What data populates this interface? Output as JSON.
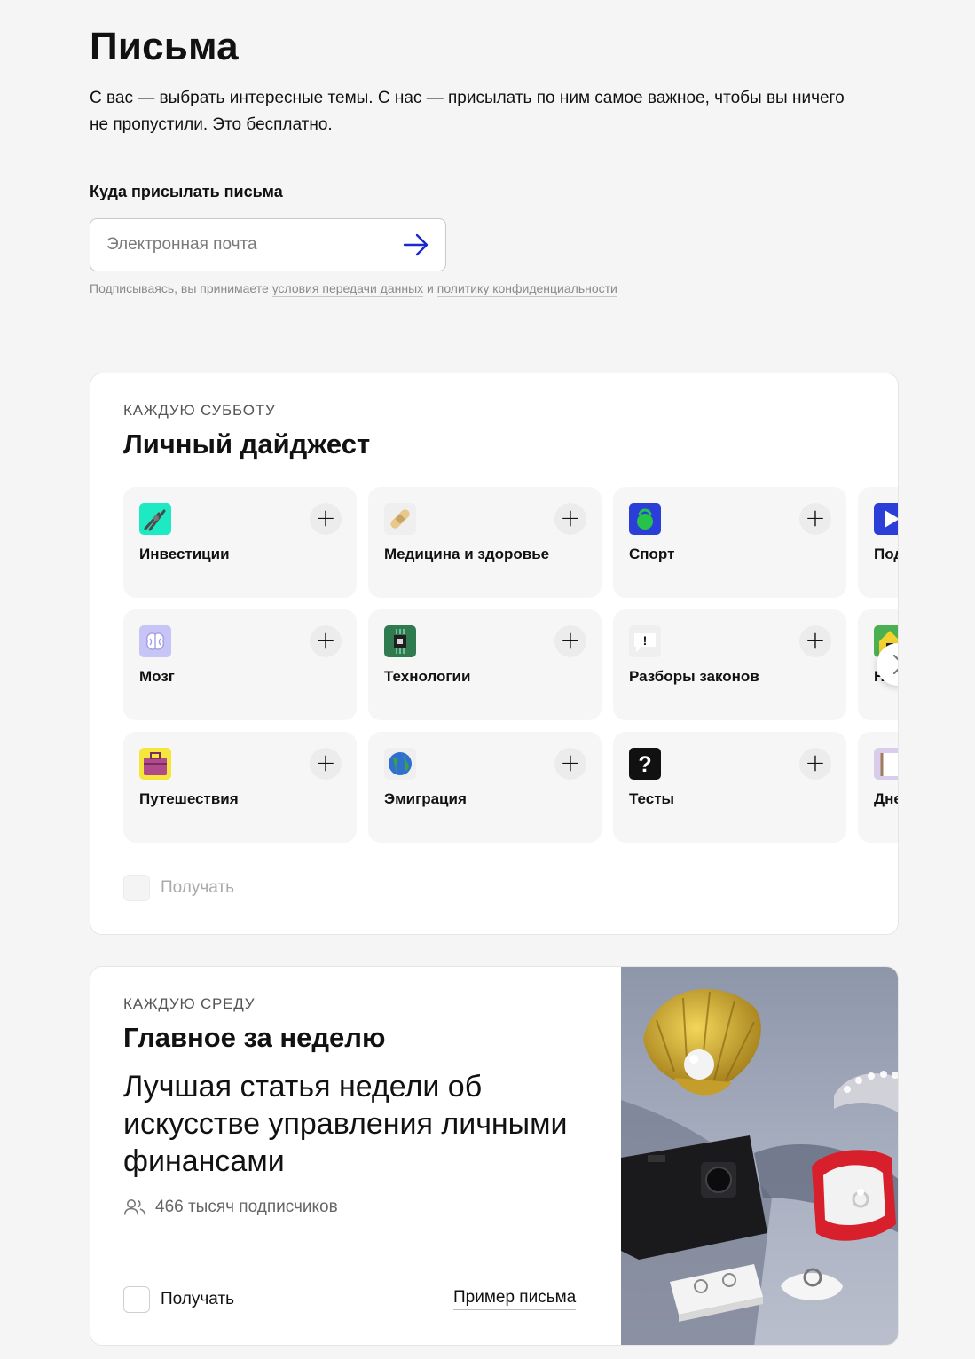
{
  "page": {
    "title": "Письма",
    "intro": "С вас — выбрать интересные темы. С нас — присылать по ним самое важное, чтобы вы ничего не пропустили. Это бесплатно."
  },
  "signup": {
    "label": "Куда присылать письма",
    "email_placeholder": "Электронная почта",
    "email_value": "",
    "consent_prefix": "Подписываясь, вы принимаете",
    "consent_link_1": "условия передачи данных",
    "consent_and": "и",
    "consent_link_2": "политику конфиденциальности"
  },
  "digest": {
    "eyebrow": "КАЖДУЮ СУББОТУ",
    "title": "Личный дайджест",
    "receive_label": "Получать",
    "receive_checked": false,
    "plus_symbol": "+",
    "topics": [
      {
        "label": "Инвестиции",
        "icon": "pliers-icon",
        "color": "#1de9c3"
      },
      {
        "label": "Медицина и здоровье",
        "icon": "bandage-icon",
        "color": "#e8c98a"
      },
      {
        "label": "Спорт",
        "icon": "kettlebell-icon",
        "color": "#2b3fd8"
      },
      {
        "label": "Под",
        "icon": "play-icon",
        "color": "#2b3fd8"
      },
      {
        "label": "Мозг",
        "icon": "brain-icon",
        "color": "#c7c5f5"
      },
      {
        "label": "Технологии",
        "icon": "chip-icon",
        "color": "#2f7a4e"
      },
      {
        "label": "Разборы законов",
        "icon": "speech-bubble-icon",
        "color": "#efefef"
      },
      {
        "label": "Н",
        "icon": "house-icon",
        "color": "#f3d230"
      },
      {
        "label": "Путешествия",
        "icon": "suitcase-icon",
        "color": "#f4e63a"
      },
      {
        "label": "Эмиграция",
        "icon": "globe-icon",
        "color": "#2f6fd0"
      },
      {
        "label": "Тесты",
        "icon": "question-icon",
        "color": "#111111"
      },
      {
        "label": "Дне",
        "icon": "diary-icon",
        "color": "#d9cdeb"
      }
    ]
  },
  "weekly": {
    "eyebrow": "КАЖДУЮ СРЕДУ",
    "title": "Главное за неделю",
    "headline": "Лучшая статья недели об искусстве управления личными финансами",
    "subscribers": "466 тысяч подписчиков",
    "receive_label": "Получать",
    "receive_checked": false,
    "example_link": "Пример письма",
    "image_icon": "still-life-photo"
  },
  "colors": {
    "background": "#f5f5f5",
    "card": "#ffffff",
    "tile": "#f6f6f6",
    "accent_arrow": "#1c28c8"
  }
}
